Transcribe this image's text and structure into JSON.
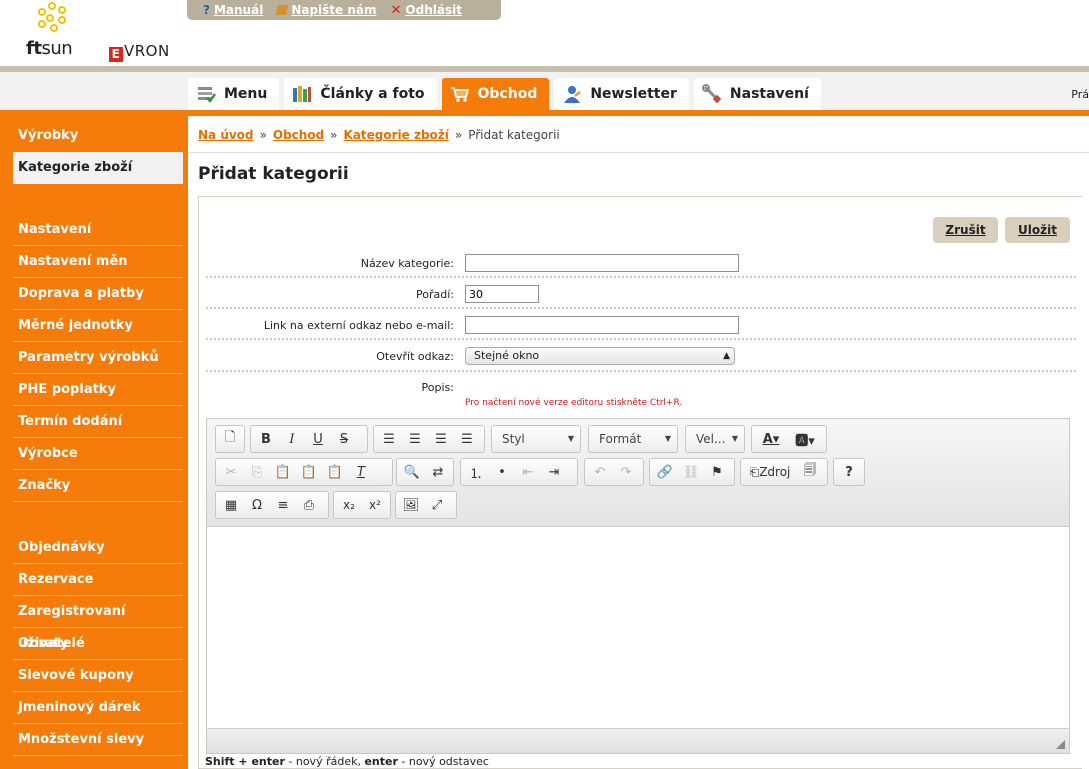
{
  "header": {
    "logo_ftsun": "ftsun",
    "logo_evron": "VRON",
    "logo_evron_initial": "E",
    "topbar": [
      {
        "label": "Manuál",
        "icon": "question-icon"
      },
      {
        "label": "Napište nám",
        "icon": "pen-icon"
      },
      {
        "label": "Odhlásit",
        "icon": "close-icon"
      }
    ]
  },
  "nav": {
    "tabs": [
      {
        "label": "Menu",
        "icon": "menu-icon",
        "active": false
      },
      {
        "label": "Články a foto",
        "icon": "books-icon",
        "active": false
      },
      {
        "label": "Obchod",
        "icon": "cart-icon",
        "active": true
      },
      {
        "label": "Newsletter",
        "icon": "user-icon",
        "active": false
      },
      {
        "label": "Nastavení",
        "icon": "wrench-icon",
        "active": false
      }
    ],
    "right_text": "Prá"
  },
  "sidebar": {
    "group1": [
      "Výrobky",
      "Kategorie zboží"
    ],
    "group2": [
      "Nastavení",
      "Nastavení měn",
      "Doprava a platby",
      "Měrné jednotky",
      "Parametry výrobků",
      "PHE poplatky",
      "Termín dodání",
      "Výrobce",
      "Značky"
    ],
    "group3": [
      "Objednávky",
      "Rezervace",
      "Zaregistrovaní uživatelé",
      "Obraty",
      "Slevové kupony",
      "Jmeninový dárek",
      "Množstevní slevy"
    ]
  },
  "breadcrumb": {
    "items": [
      "Na úvod",
      "Obchod",
      "Kategorie zboží"
    ],
    "current": "Přidat kategorii",
    "separator": "»"
  },
  "page": {
    "title": "Přidat kategorii"
  },
  "buttons": {
    "cancel": "Zrušit",
    "save": "Uložit"
  },
  "form": {
    "name_label": "Název kategorie:",
    "name_value": "",
    "order_label": "Pořadí:",
    "order_value": "30",
    "link_label": "Link na externí odkaz nebo e-mail:",
    "link_value": "",
    "open_label": "Otevřít odkaz:",
    "open_value": "Stejné okno",
    "desc_label": "Popis:",
    "editor_hint": "Pro načtení nové verze editoru stiskněte Ctrl+R."
  },
  "editor": {
    "combo_style": "Styl",
    "combo_format": "Formát",
    "combo_size": "Vel...",
    "source_label": "Zdroj"
  },
  "footer_hint": {
    "key1": "Shift + enter",
    "text1": " - nový řádek, ",
    "key2": "enter",
    "text2": " - nový odstavec"
  },
  "colors": {
    "accent": "#f57b0a",
    "topbar": "#b9b09b",
    "button": "#d8d0bd",
    "error": "#d01818"
  }
}
